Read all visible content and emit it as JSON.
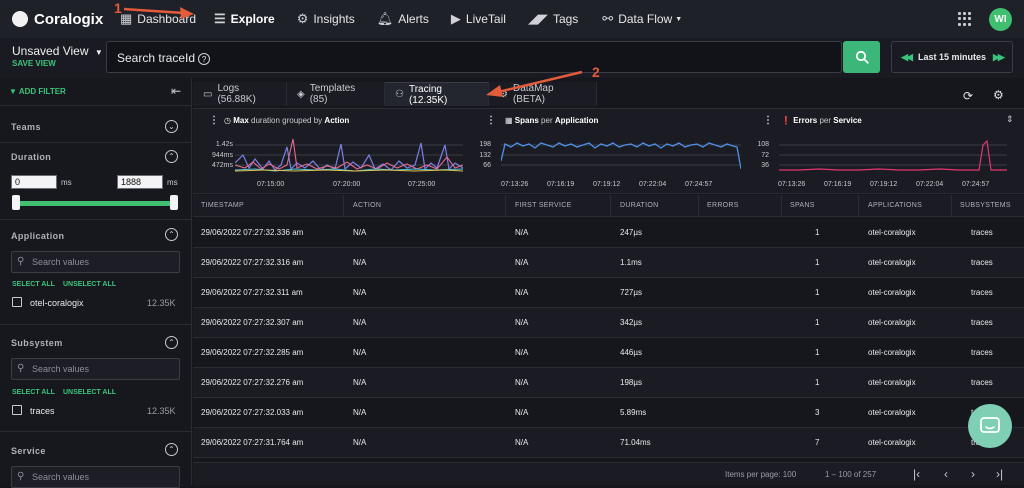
{
  "app": {
    "name": "Coralogix"
  },
  "nav": {
    "items": [
      {
        "label": "Dashboard",
        "icon": "grid-icon"
      },
      {
        "label": "Explore",
        "icon": "explore-icon"
      },
      {
        "label": "Insights",
        "icon": "gear-icon"
      },
      {
        "label": "Alerts",
        "icon": "bell-icon"
      },
      {
        "label": "LiveTail",
        "icon": "play-icon"
      },
      {
        "label": "Tags",
        "icon": "tags-icon"
      },
      {
        "label": "Data Flow",
        "icon": "dataflow-icon"
      }
    ],
    "active": "Explore",
    "avatar": "WI"
  },
  "view": {
    "title": "Unsaved View",
    "save_label": "SAVE VIEW"
  },
  "search": {
    "placeholder": "Search traceId"
  },
  "time_range": {
    "label": "Last 15 minutes"
  },
  "sidebar": {
    "add_filter": "ADD FILTER",
    "teams": "Teams",
    "duration": {
      "title": "Duration",
      "min": "0",
      "max": "1888",
      "unit": "ms"
    },
    "application": {
      "title": "Application",
      "search_placeholder": "Search values",
      "select_all": "SELECT ALL",
      "unselect_all": "UNSELECT ALL",
      "option": "otel-coralogix",
      "count": "12.35K"
    },
    "subsystem": {
      "title": "Subsystem",
      "search_placeholder": "Search values",
      "select_all": "SELECT ALL",
      "unselect_all": "UNSELECT ALL",
      "option": "traces",
      "count": "12.35K"
    },
    "service": {
      "title": "Service",
      "search_placeholder": "Search values"
    }
  },
  "tabs": [
    {
      "label": "Logs (56.88K)"
    },
    {
      "label": "Templates (85)"
    },
    {
      "label": "Tracing (12.35K)"
    },
    {
      "label": "DataMap (BETA)"
    }
  ],
  "charts": [
    {
      "metric": "Max",
      "middle": "duration grouped by",
      "dim": "Action",
      "yticks": [
        "1.42s",
        "944ms",
        "472ms"
      ],
      "xticks": [
        "07:15:00",
        "07:20:00",
        "07:25:00"
      ]
    },
    {
      "metric": "Spans",
      "middle": "per",
      "dim": "Application",
      "yticks": [
        "198",
        "132",
        "66"
      ],
      "xticks": [
        "07:13:26",
        "07:16:19",
        "07:19:12",
        "07:22:04",
        "07:24:57"
      ]
    },
    {
      "metric": "Errors",
      "middle": "per",
      "dim": "Service",
      "yticks": [
        "108",
        "72",
        "36"
      ],
      "xticks": [
        "07:13:26",
        "07:16:19",
        "07:19:12",
        "07:22:04",
        "07:24:57"
      ]
    }
  ],
  "table": {
    "columns": [
      "TIMESTAMP",
      "ACTION",
      "FIRST SERVICE",
      "DURATION",
      "ERRORS",
      "SPANS",
      "APPLICATIONS",
      "SUBSYSTEMS"
    ],
    "rows": [
      [
        "29/06/2022 07:27:32.336 am",
        "N/A",
        "N/A",
        "247µs",
        "",
        "1",
        "otel-coralogix",
        "traces"
      ],
      [
        "29/06/2022 07:27:32.316 am",
        "N/A",
        "N/A",
        "1.1ms",
        "",
        "1",
        "otel-coralogix",
        "traces"
      ],
      [
        "29/06/2022 07:27:32.311 am",
        "N/A",
        "N/A",
        "727µs",
        "",
        "1",
        "otel-coralogix",
        "traces"
      ],
      [
        "29/06/2022 07:27:32.307 am",
        "N/A",
        "N/A",
        "342µs",
        "",
        "1",
        "otel-coralogix",
        "traces"
      ],
      [
        "29/06/2022 07:27:32.285 am",
        "N/A",
        "N/A",
        "446µs",
        "",
        "1",
        "otel-coralogix",
        "traces"
      ],
      [
        "29/06/2022 07:27:32.276 am",
        "N/A",
        "N/A",
        "198µs",
        "",
        "1",
        "otel-coralogix",
        "traces"
      ],
      [
        "29/06/2022 07:27:32.033 am",
        "N/A",
        "N/A",
        "5.89ms",
        "",
        "3",
        "otel-coralogix",
        "traces"
      ],
      [
        "29/06/2022 07:27:31.764 am",
        "N/A",
        "N/A",
        "71.04ms",
        "",
        "7",
        "otel-coralogix",
        "traces"
      ]
    ]
  },
  "footer": {
    "items_per_page": "Items per page: 100",
    "range": "1 – 100 of 257"
  },
  "annotations": [
    {
      "number": "1"
    },
    {
      "number": "2"
    }
  ],
  "colors": {
    "accent": "#3db67a",
    "annotation": "#e35b3a",
    "background": "#16171d"
  }
}
